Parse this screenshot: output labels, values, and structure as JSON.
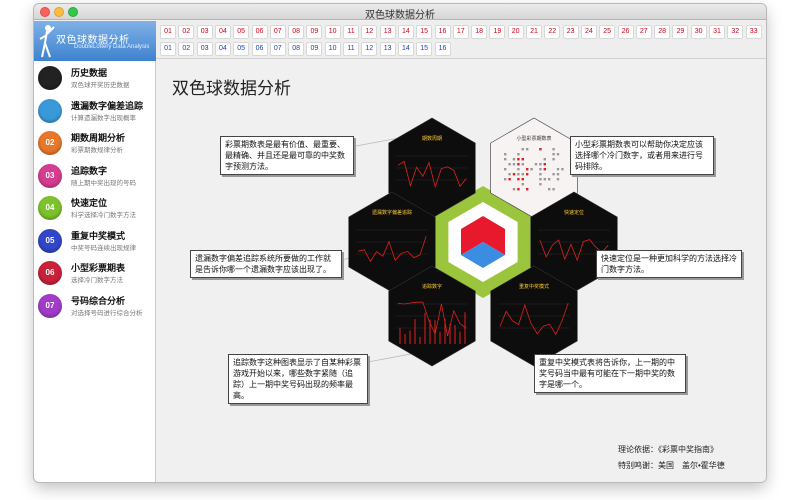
{
  "window": {
    "title": "双色球数据分析"
  },
  "logo": {
    "title": "双色球数据分析",
    "subtitle": "DoubleLottery Data Analysis"
  },
  "sidebar": {
    "items": [
      {
        "label": "历史数据",
        "sub": "双色球开奖历史数据",
        "icon": "clock-icon",
        "icon_text": "",
        "color": "#222222"
      },
      {
        "label": "遗漏数字偏差追踪",
        "sub": "计算遗漏数字出现概率",
        "icon": "magnifier-icon",
        "icon_text": "",
        "color": "#3a9ad9"
      },
      {
        "label": "期数周期分析",
        "sub": "彩票期数规律分析",
        "icon": "balls-icon",
        "icon_text": "02",
        "color": "#e8772a"
      },
      {
        "label": "追踪数字",
        "sub": "随上期中奖出现的号码",
        "icon": "balls-icon",
        "icon_text": "03",
        "color": "#d63c8f"
      },
      {
        "label": "快速定位",
        "sub": "科学选择冷门数字方法",
        "icon": "balls-icon",
        "icon_text": "04",
        "color": "#7cc22b"
      },
      {
        "label": "重复中奖模式",
        "sub": "中奖号码连续出现规律",
        "icon": "balls-icon",
        "icon_text": "05",
        "color": "#3246c8"
      },
      {
        "label": "小型彩票期表",
        "sub": "选择冷门数字方法",
        "icon": "balls-icon",
        "icon_text": "06",
        "color": "#c8213a"
      },
      {
        "label": "号码综合分析",
        "sub": "对选择号码进行综合分析",
        "icon": "balls-icon",
        "icon_text": "07",
        "color": "#a03cc8"
      }
    ]
  },
  "numbers": {
    "red": [
      "01",
      "02",
      "03",
      "04",
      "05",
      "06",
      "07",
      "08",
      "09",
      "10",
      "11",
      "12",
      "13",
      "14",
      "15",
      "16",
      "17",
      "18",
      "19",
      "20",
      "21",
      "22",
      "23",
      "24",
      "25",
      "26",
      "27",
      "28",
      "29",
      "30",
      "31",
      "32",
      "33"
    ],
    "blue": [
      "01",
      "02",
      "03",
      "04",
      "05",
      "06",
      "07",
      "08",
      "09",
      "10",
      "11",
      "12",
      "13",
      "14",
      "15",
      "16"
    ]
  },
  "main": {
    "title": "双色球数据分析",
    "callouts": {
      "top_left": "彩票期数表是最有价值、最重要、最精确、并且还是最可靠的中奖数字预测方法。",
      "top_right": "小型彩票期数表可以帮助你决定应该选择哪个冷门数字，或者用来进行号码排除。",
      "mid_left": "遗漏数字偏差追踪系统所要做的工作就是告诉你哪一个遗漏数字应该出现了。",
      "mid_right": "快速定位是一种更加科学的方法选择冷门数字方法。",
      "bottom_left": "追踪数字这种图表显示了自某种彩票游戏开始以来，哪些数字紧随（追踪）上一期中奖号码出现的频率最高。",
      "bottom_right": "重复中奖模式表将告诉你，上一期的中奖号码当中最有可能在下一期中奖的数字是哪一个。"
    },
    "hex_labels": {
      "top_left": "期数周期",
      "top_right": "小型彩票期数表",
      "mid_left": "遗漏数字偏差追踪",
      "mid_right": "快速定位",
      "bottom_left": "追踪数字",
      "bottom_right": "重复中奖模式"
    },
    "footer": {
      "basis": "理论依据：《彩票中奖指南》",
      "thanks": "特别鸣谢：美国　盖尔•霍华德"
    }
  },
  "colors": {
    "accent_red": "#d0021b",
    "accent_blue": "#1f3fb3",
    "hex_dark": "#0d0d0d",
    "ring_green": "#9bc53d",
    "center_red": "#e8192c",
    "center_blue": "#3a8de0"
  }
}
